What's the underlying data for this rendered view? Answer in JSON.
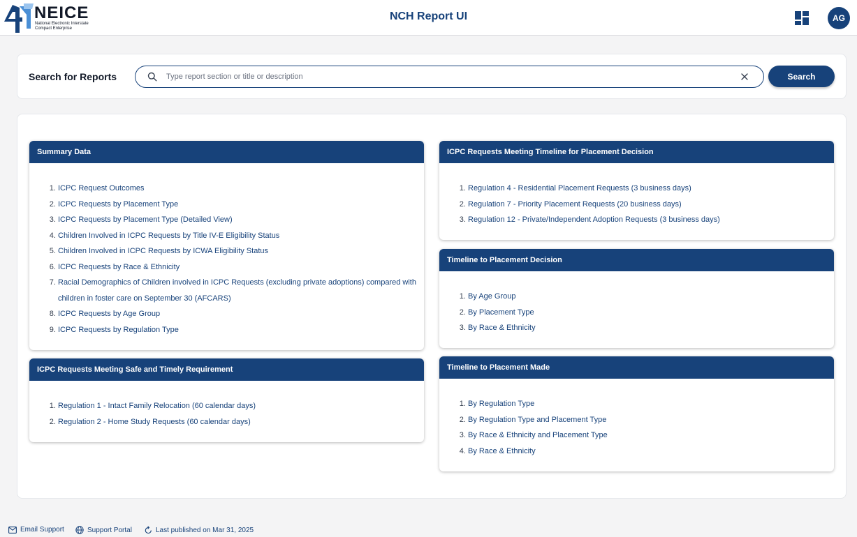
{
  "header": {
    "logo_word": "NEICE",
    "logo_sub": "National Electronic Interstate Compact Enterprise",
    "title": "NCH Report UI",
    "avatar_initials": "AG",
    "brand_color": "#17427a"
  },
  "search": {
    "label": "Search for Reports",
    "placeholder": "Type report section or title or description",
    "value": "",
    "button_label": "Search"
  },
  "sections": [
    {
      "title": "Summary Data",
      "items": [
        "ICPC Request Outcomes",
        "ICPC Requests by Placement Type",
        "ICPC Requests by Placement Type (Detailed View)",
        "Children Involved in ICPC Requests by Title IV-E Eligibility Status",
        "Children Involved in ICPC Requests by ICWA Eligibility Status",
        "ICPC Requests by Race & Ethnicity",
        "Racial Demographics of Children involved in ICPC Requests (excluding private adoptions) compared with children in foster care on September 30 (AFCARS)",
        "ICPC Requests by Age Group",
        "ICPC Requests by Regulation Type"
      ]
    },
    {
      "title": "ICPC Requests Meeting Safe and Timely Requirement",
      "items": [
        "Regulation 1 - Intact Family Relocation (60 calendar days)",
        "Regulation 2 - Home Study Requests (60 calendar days)"
      ]
    },
    {
      "title": "ICPC Requests Meeting Timeline for Placement Decision",
      "items": [
        "Regulation 4 - Residential Placement Requests (3 business days)",
        "Regulation 7 - Priority Placement Requests (20 business days)",
        "Regulation 12 - Private/Independent Adoption Requests (3 business days)"
      ]
    },
    {
      "title": "Timeline to Placement Decision",
      "items": [
        "By Age Group",
        "By Placement Type",
        "By Race & Ethnicity"
      ]
    },
    {
      "title": "Timeline to Placement Made",
      "items": [
        "By Regulation Type",
        "By Regulation Type and Placement Type",
        "By Race & Ethnicity and Placement Type",
        "By Race & Ethnicity"
      ]
    }
  ],
  "footer": {
    "email_support": "Email Support",
    "support_portal": "Support Portal",
    "last_published": "Last published on Mar 31, 2025"
  }
}
